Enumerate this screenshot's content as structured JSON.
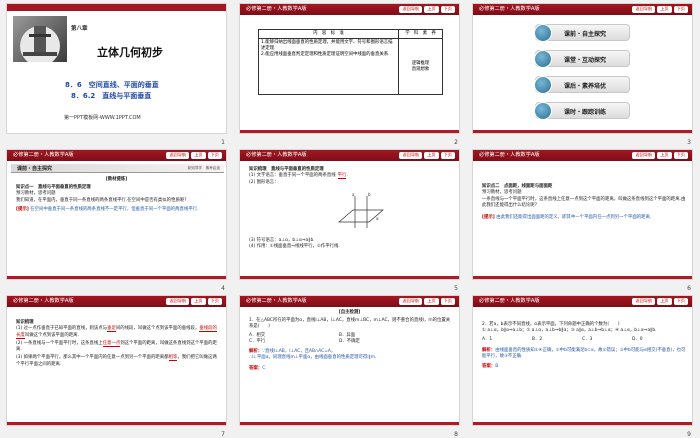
{
  "header": {
    "title": "必修第二册・人教数学A版",
    "nav_label": "返回导航",
    "prev_label": "上页",
    "next_label": "下页"
  },
  "slides": [
    {
      "num": "1",
      "chapter": "第八章",
      "book_title": "立体几何初步",
      "section_1": "8．6　空间直线、平面的垂直",
      "section_2": "8．6.2　直线与平面垂直",
      "footer": "第一PPT模板网-WWW.1PPT.COM"
    },
    {
      "num": "2",
      "col1": "内　容　标　准",
      "col2": "学　科　素　养",
      "std_1": "1.能够归纳出线面垂直的性质定理，并能用文字、符号和图形语言描述定理.",
      "std_2": "2.能应用线面垂直判定定理和性质定理证明空间中线面的垂直关系.",
      "lit_1": "逻辑推理",
      "lit_2": "直观想象"
    },
    {
      "num": "3",
      "menu": [
        "课前・自主探究",
        "课堂・互动探究",
        "课后・素养培优",
        "课时・跟踪训练"
      ]
    },
    {
      "num": "4",
      "band": "课前・自主探究",
      "band_right": "新知导学　素养启迪",
      "heading": "[教材提炼]",
      "point": "知识点一　直线与平面垂直的性质定理",
      "guide": "预习教材，思考问题",
      "question": "我们知道，在平面内，垂直于同一条直线的两条直线平行.在空间中是否有类似的性质呢?",
      "hint_label": "[提示]",
      "hint": "在空间中垂直于同一条直线的两条直线不一定平行，但垂直于同一个平面的两直线平行."
    },
    {
      "num": "5",
      "title": "知识梳理　直线与平面垂直的性质定理",
      "l1_pre": "(1) 文字语言：垂直于同一个平面的两条直线",
      "l1_ans": "平行",
      "l2": "(2) 图形语言：",
      "l3": "(3) 符号语言：a⊥α，b⊥α⇒a∥b.",
      "l4": "(4) 作用：①线面垂直⇒线线平行，②作平行线."
    },
    {
      "num": "6",
      "point": "知识点二　点面距，线面距与面面距",
      "guide": "预习教材，思考问题",
      "question": "一条直线与一个平面平行时，这条直线上任意一点到这个平面的距离，叫做这条直线到这个平面的距离.由此我们还能得出什么结论呢?",
      "hint_label": "[提示]",
      "hint": "由此我们还能得出面面距的定义，即其中一个平面内任一点到另一个平面的距离."
    },
    {
      "num": "7",
      "title": "知识梳理",
      "p1_a": "(1) 过一点作垂直于已知平面的直线，则该点与",
      "p1_b": "垂足",
      "p1_c": "间的线段，叫做这个点到该平面的垂线段，",
      "p1_d": "垂线段的长度",
      "p1_e": "叫做这个点到该平面的距离.",
      "p2_a": "(2) 一条直线与一个平面平行时，这条直线上",
      "p2_b": "任意一点",
      "p2_c": "到这个平面的距离，叫做这条直线到这个平面的距离.",
      "p3_a": "(3) 如果两个平面平行，那么其中一个平面内的任意一点到另一个平面的距离都",
      "p3_b": "相等",
      "p3_c": "，我们把它叫做这两个平行平面之间的距离."
    },
    {
      "num": "8",
      "heading": "[自主检测]",
      "q": "1．在△ABC所在的平面为α，直线l⊥AB，l⊥AC，直线m⊥BC，m⊥AC，则不重合的直线l，m的位置关系是(　　)",
      "opts": [
        "A．相交",
        "B．异面",
        "C．平行",
        "D．不确定"
      ],
      "sol_label": "解析：",
      "sol_1": "∵直线l⊥AB，l⊥AC，且AB∩AC=A，",
      "sol_2": "∴l⊥平面α，同理直线m⊥平面α，由线面垂直的性质定理可得l∥m.",
      "ans_label": "答案：",
      "ans": "C"
    },
    {
      "num": "9",
      "q": "2．若a，b表示不同直线，α表示平面，下列命题中正确的个数为(　　)",
      "items": "① a⊥α，b∥α⇒a⊥b；② a⊥α，a⊥b⇒b∥α；③ a∥α，a⊥b⇒b⊥α；④ a⊥α，b⊥α⇒a∥b.",
      "opts": [
        "A．1",
        "B．2",
        "C．3",
        "D．0"
      ],
      "sol_label": "解析：",
      "sol": "由线面垂直的性质知①④正确，②中b可能满足b⊂α，故②错误；③中b可能与α相交(不垂直)，也可能平行，故③不正确.",
      "ans_label": "答案：",
      "ans": "B"
    }
  ]
}
